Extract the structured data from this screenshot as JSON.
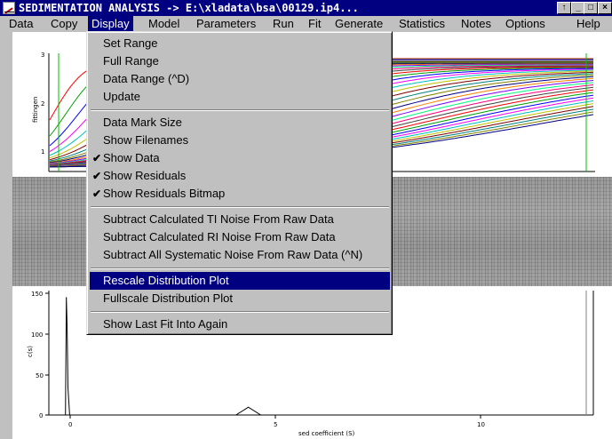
{
  "window": {
    "title": "SEDIMENTATION ANALYSIS -> E:\\xladata\\bsa\\00129.ip4...",
    "buttons": {
      "up": "↑",
      "minimize": "_",
      "maximize": "□",
      "close": "×"
    }
  },
  "menubar": {
    "items": [
      {
        "label": "Data"
      },
      {
        "label": "Copy"
      },
      {
        "label": "Display"
      },
      {
        "label": "Model"
      },
      {
        "label": "Parameters"
      },
      {
        "label": "Run"
      },
      {
        "label": "Fit"
      },
      {
        "label": "Generate"
      },
      {
        "label": "Statistics"
      },
      {
        "label": "Notes"
      },
      {
        "label": "Options"
      },
      {
        "label": "Help"
      }
    ]
  },
  "display_menu": {
    "items": [
      {
        "label": "Set Range"
      },
      {
        "label": "Full Range"
      },
      {
        "label": "Data Range (^D)"
      },
      {
        "label": "Update"
      },
      {
        "label": "Data Mark Size"
      },
      {
        "label": "Show Filenames"
      },
      {
        "label": "Show Data",
        "checked": true
      },
      {
        "label": "Show Residuals",
        "checked": true
      },
      {
        "label": "Show Residuals Bitmap",
        "checked": true
      },
      {
        "label": "Subtract Calculated TI Noise From Raw Data"
      },
      {
        "label": "Subtract Calculated RI Noise From Raw Data"
      },
      {
        "label": "Subtract All Systematic Noise From Raw Data (^N)"
      },
      {
        "label": "Rescale Distribution Plot",
        "selected": true
      },
      {
        "label": "Fullscale Distribution Plot"
      },
      {
        "label": "Show Last Fit Into Again"
      }
    ]
  },
  "data_plot": {
    "ylabel": "fittingen",
    "yticks": [
      "3",
      "2",
      "1"
    ]
  },
  "distribution_plot": {
    "ylabel": "c(s)",
    "xlabel": "sed coefficient (S)",
    "yticks": [
      "150",
      "100",
      "50",
      "0"
    ],
    "xticks": [
      "0",
      "5",
      "10"
    ]
  },
  "chart_data": [
    {
      "type": "line",
      "ylabel": "fittingen",
      "ylim": [
        0.7,
        3.0
      ],
      "note_series": "many overlaid boundary scans in assorted colors rising toward plateau ~2.9"
    },
    {
      "type": "line",
      "xlabel": "sed coefficient (S)",
      "ylabel": "c(s)",
      "xlim": [
        -0.3,
        12.8
      ],
      "ylim": [
        0,
        155
      ],
      "x": [
        0.1,
        0.12,
        0.14,
        0.16,
        0.2,
        4.2,
        4.5,
        4.8,
        12.5
      ],
      "y": [
        0,
        150,
        110,
        35,
        0,
        0,
        10,
        0,
        0
      ]
    }
  ],
  "colors": {
    "title_bg": "#000080",
    "selection": "#000080",
    "face": "#c0c0c0"
  }
}
